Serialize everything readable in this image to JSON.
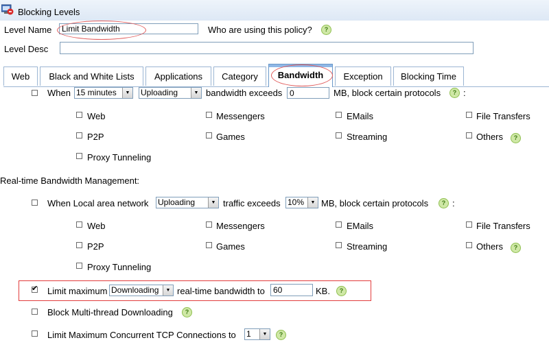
{
  "window": {
    "title": "Blocking Levels"
  },
  "form": {
    "level_name_label": "Level Name",
    "level_name_value": "Limit Bandwidth",
    "who_using_label": "Who are using this policy?",
    "level_desc_label": "Level Desc",
    "level_desc_value": ""
  },
  "tabs": [
    "Web",
    "Black and White Lists",
    "Applications",
    "Category",
    "Bandwidth",
    "Exception",
    "Blocking Time"
  ],
  "active_tab": "Bandwidth",
  "total_bw": {
    "when": "When",
    "period": "15 minutes",
    "direction": "Uploading",
    "exceeds_text": "bandwidth exceeds",
    "amount": "0",
    "suffix": "MB, block certain protocols",
    "colon": ":",
    "protocols": [
      "Web",
      "Messengers",
      "EMails",
      "File Transfers",
      "P2P",
      "Games",
      "Streaming",
      "Others",
      "Proxy Tunneling"
    ]
  },
  "realtime": {
    "section_label": "Real-time Bandwidth Management:",
    "when_text": "When Local area network",
    "direction": "Uploading",
    "exceeds_text": "traffic exceeds",
    "percent": "10%",
    "suffix": "MB, block certain protocols",
    "colon": ":",
    "protocols": [
      "Web",
      "Messengers",
      "EMails",
      "File Transfers",
      "P2P",
      "Games",
      "Streaming",
      "Others",
      "Proxy Tunneling"
    ]
  },
  "limit_max": {
    "checked": true,
    "label": "Limit maximum",
    "direction": "Downloading",
    "middle": "real-time bandwidth to",
    "value": "60",
    "unit": "KB."
  },
  "block_multithread": {
    "checked": false,
    "label": "Block Multi-thread Downloading"
  },
  "limit_tcp": {
    "checked": false,
    "label": "Limit Maximum Concurrent TCP Connections to",
    "value": "1"
  },
  "help_glyph": "?"
}
